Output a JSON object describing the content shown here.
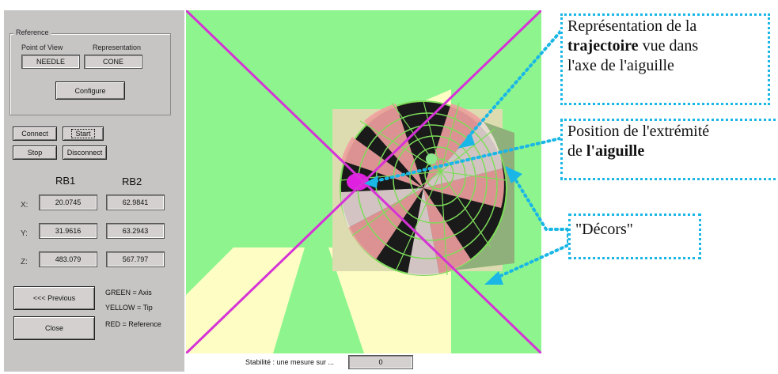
{
  "reference": {
    "title": "Reference",
    "pov_label": "Point of View",
    "rep_label": "Representation",
    "pov_value": "NEEDLE",
    "rep_value": "CONE",
    "configure_label": "Configure"
  },
  "controls": {
    "connect_label": "Connect",
    "start_label": "Start",
    "stop_label": "Stop",
    "disconnect_label": "Disconnect"
  },
  "coords": {
    "col1": "RB1",
    "col2": "RB2",
    "x_label": "X:",
    "y_label": "Y:",
    "z_label": "Z:",
    "rb1": {
      "x": "20.0745",
      "y": "31.9616",
      "z": "483.079"
    },
    "rb2": {
      "x": "62.9841",
      "y": "63.2943",
      "z": "567.797"
    }
  },
  "nav": {
    "previous_label": "<<< Previous",
    "close_label": "Close"
  },
  "legend": {
    "green": "GREEN = Axis",
    "yellow": "YELLOW = Tip",
    "red": "RED = Reference"
  },
  "status": {
    "label": "Stabilité : une mesure sur ...",
    "value": "0"
  },
  "annotations": {
    "trajectory": {
      "pre": "Représentation de la",
      "bold": "trajectoire",
      "post1": " vue dans",
      "post2": "l'axe de l'aiguille"
    },
    "position": {
      "line1": "Position de l'extrémité",
      "pre2": "de ",
      "bold": "l'aiguille"
    },
    "decor": {
      "text": "\"Décors\""
    }
  },
  "colors": {
    "panel": "#c7c4c4",
    "view_background": "#8ef58e",
    "cross": "#d633d6",
    "annotation_border": "#19b6e6"
  }
}
